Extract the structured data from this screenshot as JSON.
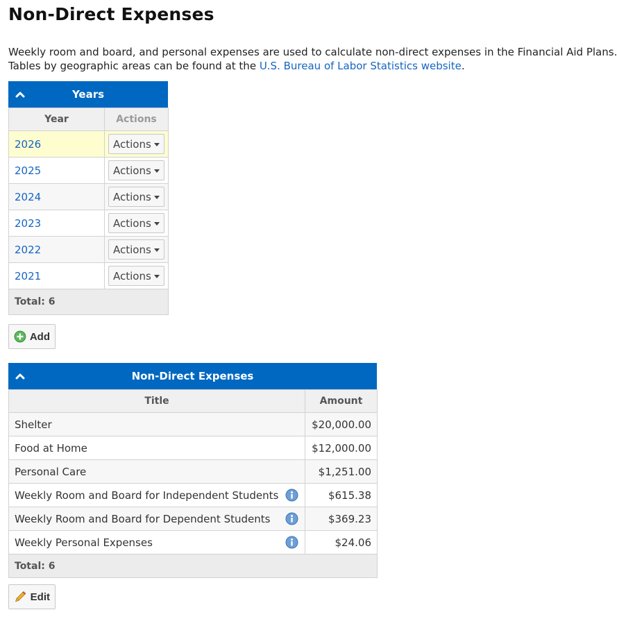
{
  "page": {
    "title": "Non-Direct Expenses",
    "intro_line1": "Weekly room and board, and personal expenses are used to calculate non-direct expenses in the Financial Aid Plans.",
    "intro_line2_prefix": "Tables by geographic areas can be found at the ",
    "intro_link": "U.S. Bureau of Labor Statistics website",
    "intro_line2_suffix": "."
  },
  "years_panel": {
    "header": "Years",
    "col_year": "Year",
    "col_actions": "Actions",
    "rows": [
      {
        "year": "2026",
        "action": "Actions"
      },
      {
        "year": "2025",
        "action": "Actions"
      },
      {
        "year": "2024",
        "action": "Actions"
      },
      {
        "year": "2023",
        "action": "Actions"
      },
      {
        "year": "2022",
        "action": "Actions"
      },
      {
        "year": "2021",
        "action": "Actions"
      }
    ],
    "total": "Total: 6",
    "add_label": "Add"
  },
  "expenses_panel": {
    "header": "Non-Direct Expenses",
    "col_title": "Title",
    "col_amount": "Amount",
    "rows": [
      {
        "title": "Shelter",
        "amount": "$20,000.00"
      },
      {
        "title": "Food at Home",
        "amount": "$12,000.00"
      },
      {
        "title": "Personal Care",
        "amount": "$1,251.00"
      },
      {
        "title": "Weekly Room and Board for Independent Students",
        "amount": "$615.38"
      },
      {
        "title": "Weekly Room and Board for Dependent Students",
        "amount": "$369.23"
      },
      {
        "title": "Weekly Personal Expenses",
        "amount": "$24.06"
      }
    ],
    "total": "Total: 6",
    "edit_label": "Edit"
  },
  "colors": {
    "header_blue": "#0068c0",
    "link_blue": "#1565c0",
    "highlight_row": "#fdfdd0"
  },
  "icons": [
    "chevron-up-icon",
    "caret-down-icon",
    "add-circle-icon",
    "info-icon",
    "pencil-icon"
  ]
}
